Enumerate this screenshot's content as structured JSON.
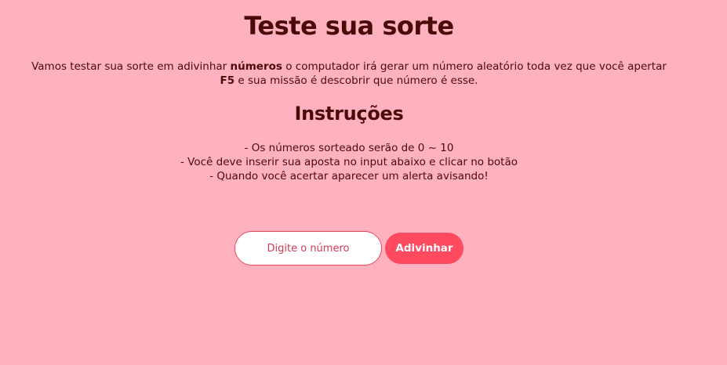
{
  "header": {
    "title": "Teste sua sorte"
  },
  "intro": {
    "part1": "Vamos testar sua sorte em adivinhar ",
    "bold1": "números",
    "part2": " o computador irá gerar um número aleatório toda vez que você apertar ",
    "bold2": "F5",
    "part3": " e sua missão é descobrir que número é esse."
  },
  "instructions": {
    "heading": "Instruções",
    "items": [
      "- Os números sorteado serão de 0 ~ 10",
      "- Você deve inserir sua aposta no input abaixo e clicar no botão",
      "- Quando você acertar aparecer um alerta avisando!"
    ]
  },
  "form": {
    "input_value": "",
    "input_placeholder": "Digite o número",
    "button_label": "Adivinhar"
  },
  "colors": {
    "background": "#ffb1c0",
    "text": "#4a0a0a",
    "accent": "#ff4a5f"
  }
}
